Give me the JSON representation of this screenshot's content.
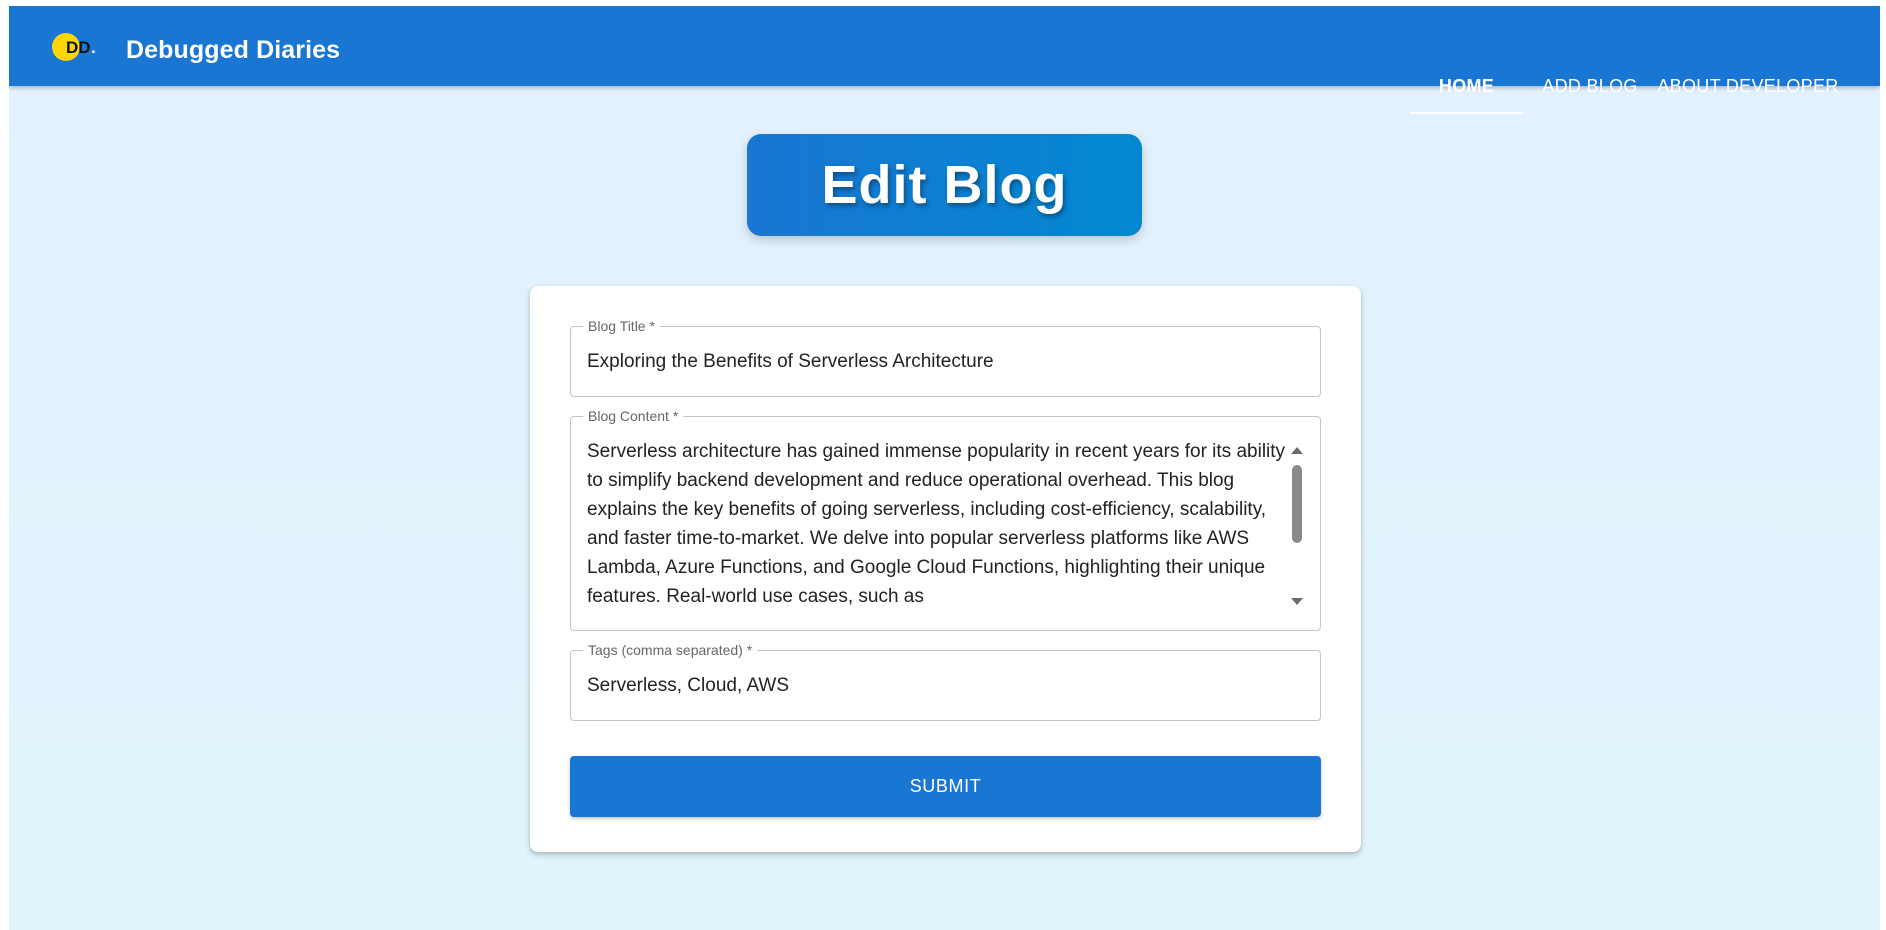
{
  "app": {
    "brand_name": "Debugged Diaries",
    "logo_text": "DD.",
    "logo_colors": {
      "circle": "#ffd600",
      "text": "#111111"
    }
  },
  "nav": {
    "items": [
      {
        "label": "HOME",
        "active": true
      },
      {
        "label": "ADD BLOG",
        "active": false
      },
      {
        "label": "ABOUT DEVELOPER",
        "active": false
      }
    ]
  },
  "page": {
    "heading": "Edit Blog"
  },
  "form": {
    "title": {
      "label": "Blog Title *",
      "value": "Exploring the Benefits of Serverless Architecture"
    },
    "content": {
      "label": "Blog Content *",
      "value": "Serverless architecture has gained immense popularity in recent years for its ability to simplify backend development and reduce operational overhead. This blog explains the key benefits of going serverless, including cost-efficiency, scalability, and faster time-to-market. We delve into popular serverless platforms like AWS Lambda, Azure Functions, and Google Cloud Functions, highlighting their unique features. Real-world use cases, such as"
    },
    "tags": {
      "label": "Tags (comma separated) *",
      "value": "Serverless, Cloud, AWS"
    },
    "submit_label": "SUBMIT"
  },
  "colors": {
    "primary": "#1976d2",
    "page_background": "#e1f2fc",
    "card_background": "#ffffff",
    "field_border": "#c4c4c4"
  }
}
